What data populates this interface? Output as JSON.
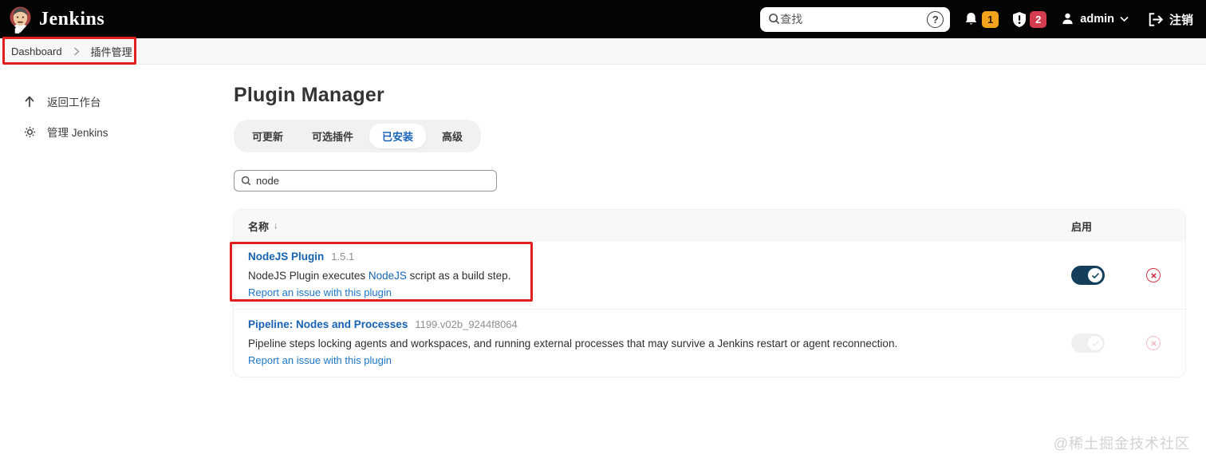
{
  "header": {
    "brand": "Jenkins",
    "search_placeholder": "查找",
    "notification_count": "1",
    "security_count": "2",
    "user": "admin",
    "logout_label": "注销"
  },
  "breadcrumb": {
    "items": {
      "0": "Dashboard",
      "1": "插件管理"
    }
  },
  "sidebar": {
    "back_label": "返回工作台",
    "manage_label": "管理 Jenkins"
  },
  "main": {
    "title": "Plugin Manager",
    "tabs": {
      "0": {
        "label": "可更新"
      },
      "1": {
        "label": "可选插件"
      },
      "2": {
        "label": "已安装"
      },
      "3": {
        "label": "高级"
      }
    },
    "filter_value": "node",
    "table": {
      "name_header": "名称",
      "sort_indicator": "↓",
      "enable_header": "启用",
      "rows": {
        "0": {
          "name": "NodeJS Plugin",
          "version": "1.5.1",
          "desc_prefix": "NodeJS Plugin executes ",
          "desc_link": "NodeJS",
          "desc_suffix": " script as a build step.",
          "report_link": "Report an issue with this plugin",
          "enabled": "on"
        },
        "1": {
          "name": "Pipeline: Nodes and Processes",
          "version": "1199.v02b_9244f8064",
          "description": "Pipeline steps locking agents and workspaces, and running external processes that may survive a Jenkins restart or agent reconnection.",
          "report_link": "Report an issue with this plugin",
          "enabled": "disabled"
        }
      }
    }
  },
  "watermark": "@稀土掘金技术社区",
  "colors": {
    "accent_link": "#1762b3",
    "toggle_on": "#133f5c",
    "danger": "#d63649",
    "annotation": "#e02020",
    "badge_orange": "#f2a21b",
    "badge_red": "#d43d4f"
  }
}
